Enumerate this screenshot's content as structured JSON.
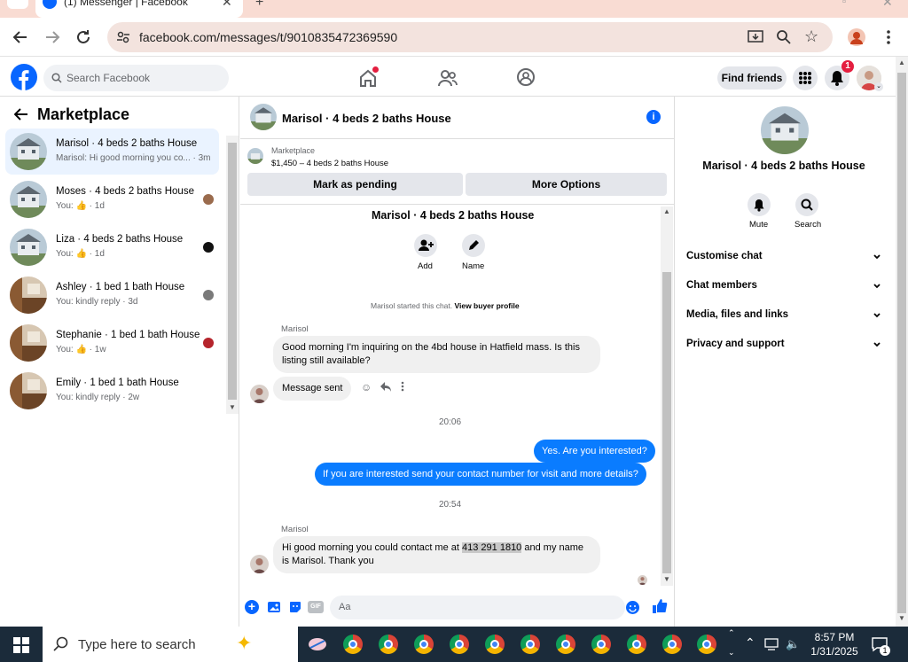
{
  "browser": {
    "tab_title": "(1) Messenger | Facebook",
    "url": "facebook.com/messages/t/9010835472369590"
  },
  "fb_header": {
    "search_placeholder": "Search Facebook",
    "find_friends": "Find friends",
    "notifications_count": "1"
  },
  "left_panel": {
    "title": "Marketplace",
    "conversations": [
      {
        "name": "Marisol · 4 beds 2 baths House",
        "preview": "Marisol: Hi good morning you co... · 3m",
        "thumb": "house-white",
        "avatar_color": "",
        "active": true
      },
      {
        "name": "Moses · 4 beds 2 baths House",
        "preview": "You:",
        "time": "1d",
        "thumb": "house-white",
        "avatar_color": "#9a6b4d"
      },
      {
        "name": "Liza · 4 beds 2 baths House",
        "preview": "You:",
        "time": "1d",
        "thumb": "house-white",
        "avatar_color": "#111111"
      },
      {
        "name": "Ashley · 1 bed 1 bath House",
        "preview": "You: kindly reply · 3d",
        "thumb": "room-wood",
        "avatar_color": "#7a7a7a"
      },
      {
        "name": "Stephanie · 1 bed 1 bath House",
        "preview": "You:",
        "time": "1w",
        "thumb": "room-wood",
        "avatar_color": "#b5242c"
      },
      {
        "name": "Emily · 1 bed 1 bath House",
        "preview": "You: kindly reply · 2w",
        "thumb": "room-wood",
        "avatar_color": ""
      }
    ]
  },
  "chat": {
    "header_title": "Marisol · 4 beds 2 baths House",
    "marketplace_label": "Marketplace",
    "listing_line": "$1,450 – 4 beds 2 baths House",
    "mark_pending": "Mark as pending",
    "more_options": "More Options",
    "thread_title": "Marisol · 4 beds 2 baths House",
    "add_label": "Add",
    "name_label": "Name",
    "started_text": "Marisol started this chat. ",
    "view_buyer_profile": "View buyer profile",
    "sender_1": "Marisol",
    "msg_1": "Good morning I'm inquiring on the 4bd house in Hatfield mass. Is this listing still available?",
    "msg_sent": "Message sent",
    "time_1": "20:06",
    "out_1": "Yes. Are you interested?",
    "out_2": "If you are interested send your contact number for visit and more details?",
    "time_2": "20:54",
    "sender_2": "Marisol",
    "msg_2_before": "Hi good morning you could contact me at ",
    "msg_2_phone": "413 291 1810",
    "msg_2_after": " and my name is Marisol. Thank you",
    "compose_placeholder": "Aa"
  },
  "right_panel": {
    "title": "Marisol · 4 beds 2 baths House",
    "mute": "Mute",
    "search": "Search",
    "sections": [
      "Customise chat",
      "Chat members",
      "Media, files and links",
      "Privacy and support"
    ]
  },
  "taskbar": {
    "search_text": "Type here to search",
    "time": "8:57 PM",
    "date": "1/31/2025",
    "chat_badge": "1"
  },
  "colors": {
    "fb_blue": "#0866ff",
    "messenger_blue": "#0a7cff",
    "tab_strip": "#f9dcd3",
    "taskbar": "#1b2b3a"
  }
}
